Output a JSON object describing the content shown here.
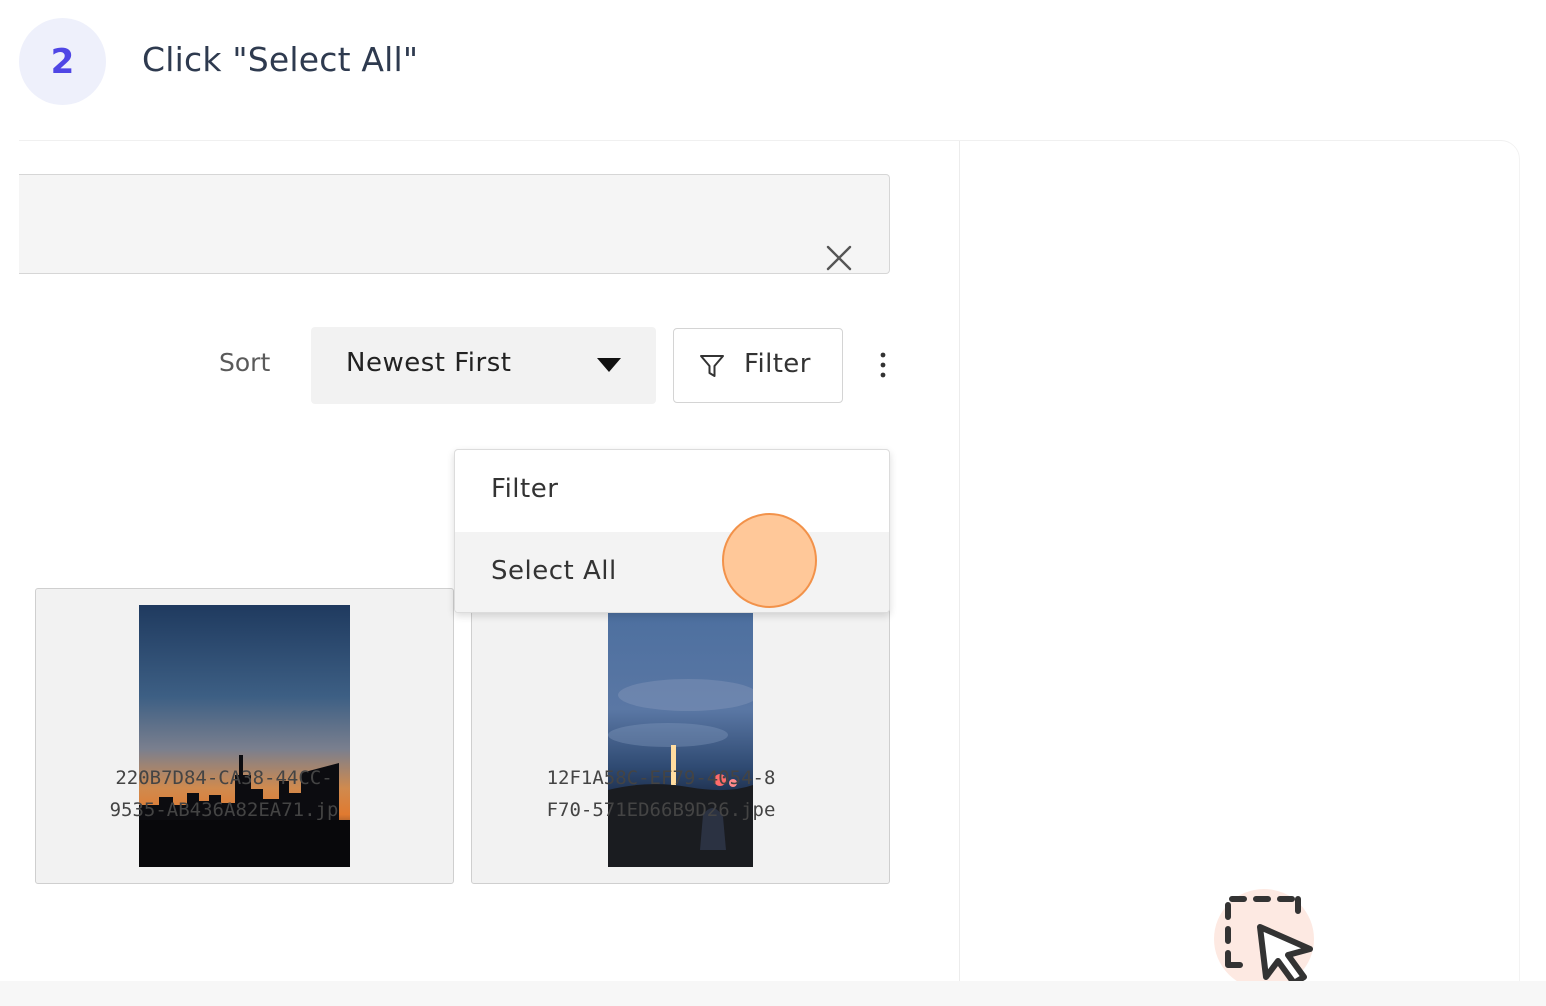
{
  "step": {
    "number": "2",
    "title": "Click \"Select All\""
  },
  "toolbar": {
    "sort_label": "Sort",
    "sort_value": "Newest First",
    "filter_label": "Filter"
  },
  "dropdown": {
    "items": [
      {
        "label": "Filter"
      },
      {
        "label": "Select All"
      }
    ]
  },
  "files": [
    {
      "line1": "220B7D84-CA38-44CC-",
      "line2": "9535-AB436A82EA71.jp"
    },
    {
      "line1": "12F1A58C-EF79-4054-8",
      "line2": "F70-571ED66B9D26.jpe"
    }
  ],
  "colors": {
    "accent": "#4f46e5",
    "click_indicator": "#ffc899",
    "click_indicator_border": "#f2924a"
  },
  "icons": {
    "close": "close-icon",
    "caret": "caret-down-icon",
    "filter": "filter-icon",
    "more": "more-vertical-icon",
    "select": "select-pointer-icon"
  }
}
